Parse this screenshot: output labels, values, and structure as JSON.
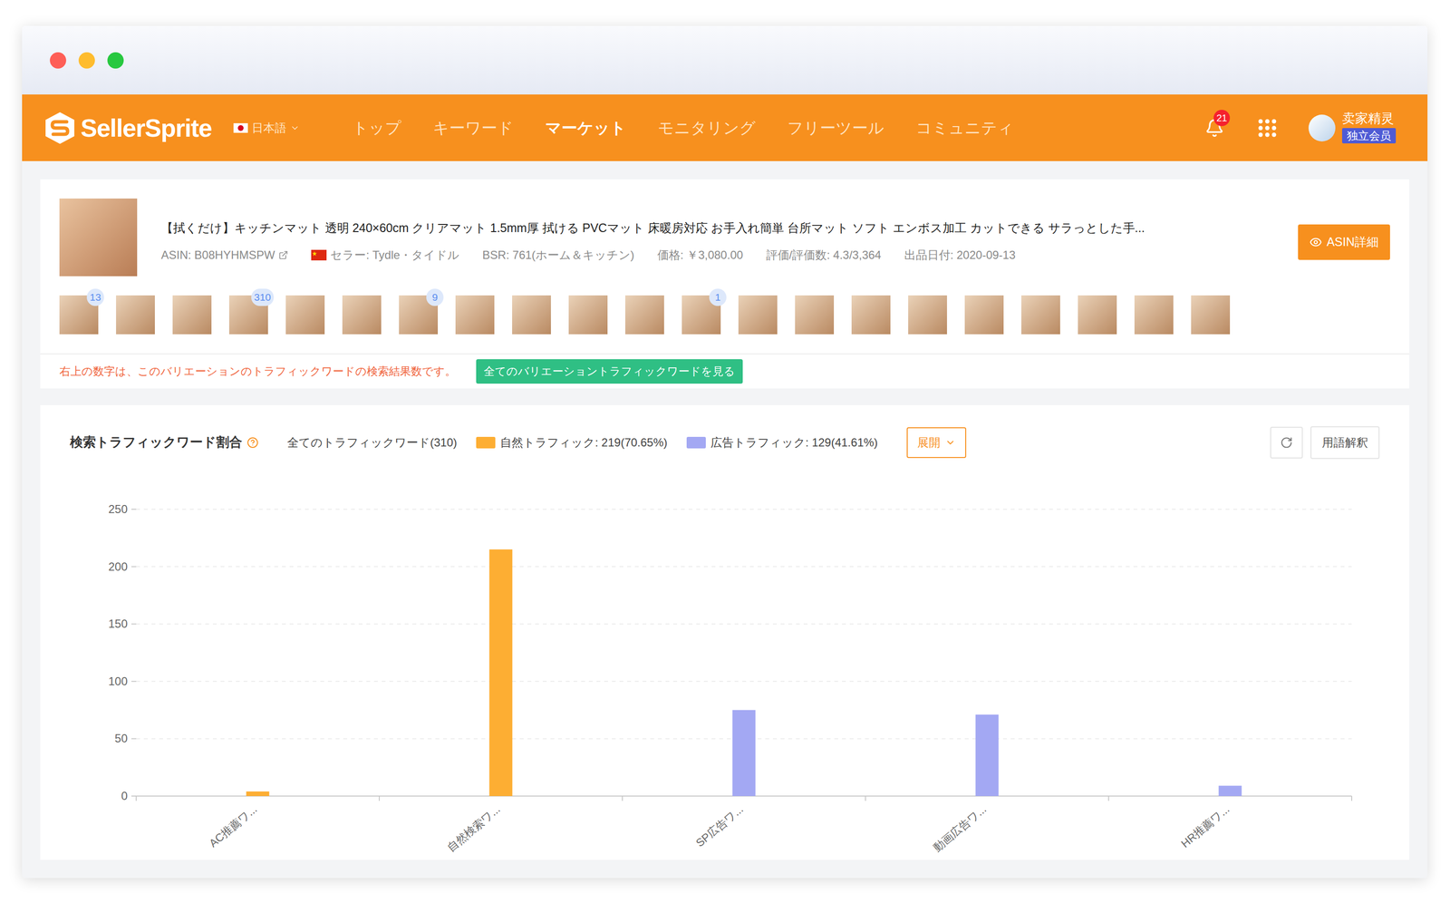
{
  "nav": {
    "logo": "SellerSprite",
    "language": "日本語",
    "items": [
      {
        "label": "トップ",
        "selected": false
      },
      {
        "label": "キーワード",
        "selected": false
      },
      {
        "label": "マーケット",
        "selected": true
      },
      {
        "label": "モニタリング",
        "selected": false
      },
      {
        "label": "フリーツール",
        "selected": false
      },
      {
        "label": "コミュニティ",
        "selected": false
      }
    ],
    "notifications": "21",
    "user": {
      "name": "卖家精灵",
      "badge": "独立会员"
    }
  },
  "product": {
    "title": "【拭くだけ】キッチンマット 透明 240×60cm クリアマット 1.5mm厚 拭ける PVCマット 床暖房対応 お手入れ簡単 台所マット ソフト エンボス加工 カットできる サラっとした手...",
    "meta": [
      {
        "kind": "asin",
        "text": "ASIN: B08HYHMSPW"
      },
      {
        "kind": "seller",
        "text": "セラー: Tydle・タイドル"
      },
      {
        "kind": "plain",
        "text": "BSR: 761(ホーム＆キッチン)"
      },
      {
        "kind": "plain",
        "text": "価格: ￥3,080.00"
      },
      {
        "kind": "plain",
        "text": "評価/評価数: 4.3/3,364"
      },
      {
        "kind": "plain",
        "text": "出品日付: 2020-09-13"
      }
    ],
    "button": "ASIN詳細",
    "thumbnails": [
      {
        "badge": "13"
      },
      {
        "badge": null
      },
      {
        "badge": null
      },
      {
        "badge": "310"
      },
      {
        "badge": null
      },
      {
        "badge": null
      },
      {
        "badge": "9"
      },
      {
        "badge": null
      },
      {
        "badge": null
      },
      {
        "badge": null
      },
      {
        "badge": null
      },
      {
        "badge": "1"
      },
      {
        "badge": null
      },
      {
        "badge": null
      },
      {
        "badge": null
      },
      {
        "badge": null
      },
      {
        "badge": null
      },
      {
        "badge": null
      },
      {
        "badge": null
      },
      {
        "badge": null
      },
      {
        "badge": null
      }
    ],
    "note": "右上の数字は、このバリエーションのトラフィックワードの検索結果数です。",
    "note_button": "全てのバリエーショントラフィックワードを見る"
  },
  "chart": {
    "title": "検索トラフィックワード割合",
    "total": "全てのトラフィックワード(310)",
    "legend": [
      {
        "label": "自然トラフィック: 219(70.65%)",
        "color": "#fdae33"
      },
      {
        "label": "広告トラフィック: 129(41.61%)",
        "color": "#a3a8f3"
      }
    ],
    "expand": "展開",
    "glossary": "用語解釈",
    "y_ticks": [
      "250",
      "200",
      "150",
      "100",
      "50",
      "0"
    ],
    "categories": [
      "AC推薦ワ...",
      "自然検索ワ...",
      "SP広告ワ...",
      "動画広告ワ...",
      "HR推薦ワ..."
    ],
    "series": [
      {
        "name": "natural",
        "color": "#fdae33",
        "values": [
          4,
          215,
          0,
          0,
          0
        ]
      },
      {
        "name": "ad",
        "color": "#a3a8f3",
        "values": [
          0,
          0,
          75,
          71,
          9
        ]
      }
    ]
  }
}
